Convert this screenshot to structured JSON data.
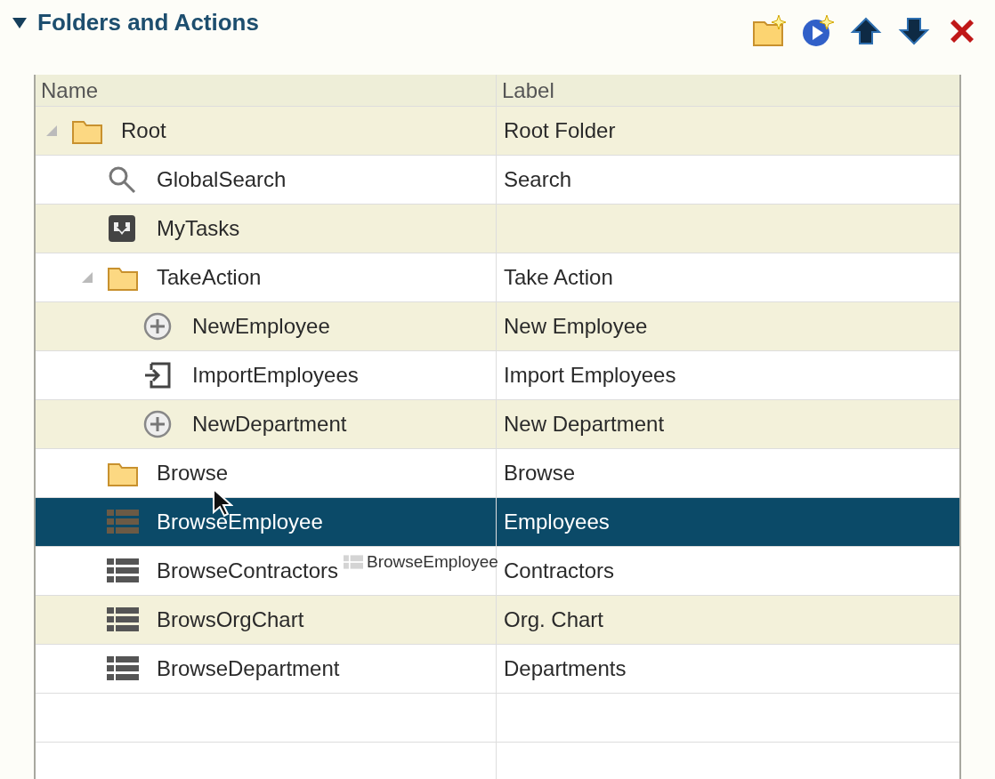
{
  "section": {
    "title": "Folders and Actions",
    "expanded": true
  },
  "table": {
    "columns": [
      "Name",
      "Label"
    ],
    "rows": [
      {
        "name": "Root",
        "label": "Root Folder",
        "kind": "folder",
        "expanded": true,
        "selected": false,
        "children": [
          {
            "name": "GlobalSearch",
            "label": "Search",
            "kind": "search",
            "selected": false
          },
          {
            "name": "MyTasks",
            "kind": "task",
            "selected": false
          },
          {
            "name": "TakeAction",
            "label": "Take Action",
            "kind": "folder",
            "expanded": true,
            "selected": false,
            "children": [
              {
                "name": "NewEmployee",
                "label": "New Employee",
                "kind": "add",
                "selected": false
              },
              {
                "name": "ImportEmployees",
                "label": "Import Employees",
                "kind": "import",
                "selected": false
              },
              {
                "name": "NewDepartment",
                "label": "New Department",
                "kind": "add",
                "selected": false
              }
            ]
          },
          {
            "name": "Browse",
            "label": "Browse",
            "kind": "folder",
            "selected": false
          },
          {
            "name": "BrowseEmployee",
            "label": "Employees",
            "kind": "list",
            "selected": true
          },
          {
            "name": "BrowseContractors",
            "label": "Contractors",
            "kind": "list",
            "selected": false
          },
          {
            "name": "BrowsOrgChart",
            "label": "Org. Chart",
            "kind": "list",
            "selected": false
          },
          {
            "name": "BrowseDepartment",
            "label": "Departments",
            "kind": "list",
            "selected": false
          }
        ]
      }
    ]
  },
  "drag_ghost": {
    "text": "BrowseEmployee"
  }
}
